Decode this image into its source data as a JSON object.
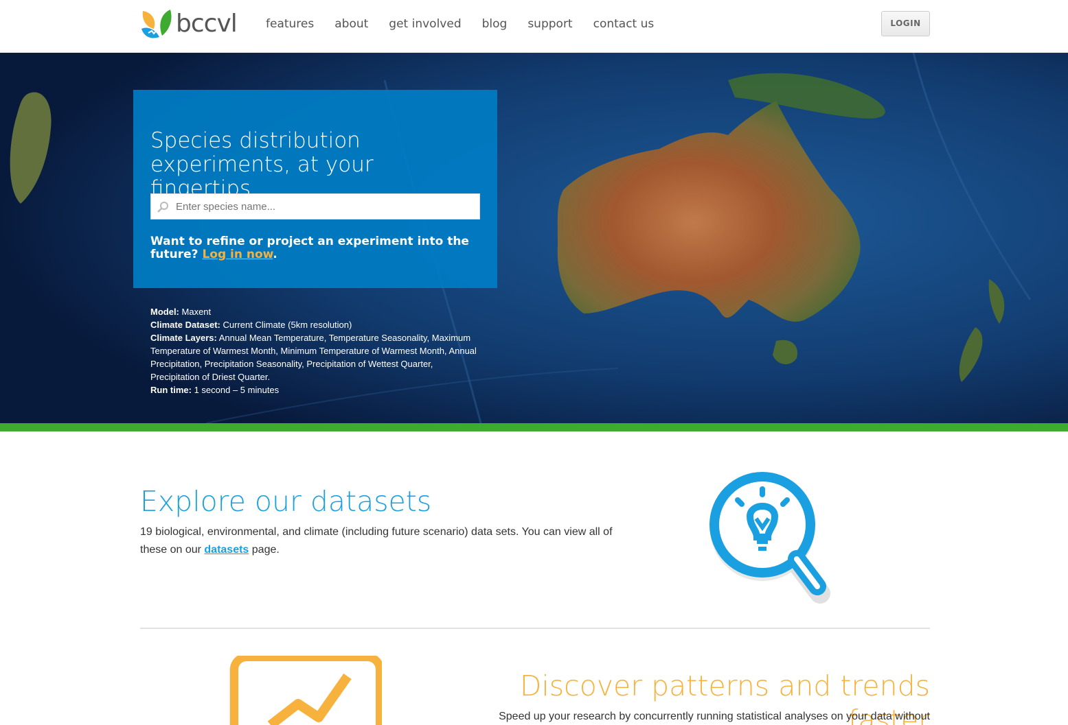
{
  "brand": {
    "name": "bccvl"
  },
  "nav": {
    "items": [
      "features",
      "about",
      "get involved",
      "blog",
      "support",
      "contact us"
    ]
  },
  "header": {
    "login_label": "LOGIN"
  },
  "hero": {
    "title": "Species distribution experiments, at your fingertips.",
    "search_placeholder": "Enter species name...",
    "refine_text": "Want to refine or project an experiment into the future?",
    "login_link": "Log in now",
    "refine_suffix": ".",
    "meta": {
      "model_label": "Model:",
      "model_value": "Maxent",
      "dataset_label": "Climate Dataset:",
      "dataset_value": "Current Climate (5km resolution)",
      "layers_label": "Climate Layers:",
      "layers_value": "Annual Mean Temperature, Temperature Seasonality, Maximum Temperature of Warmest Month, Minimum Temperature of Warmest Month, Annual Precipitation, Precipitation Seasonality, Precipitation of Wettest Quarter, Precipitation of Driest Quarter.",
      "runtime_label": "Run time:",
      "runtime_value": "1 second – 5 minutes"
    }
  },
  "datasets": {
    "title": "Explore our datasets",
    "text_before": "19 biological, environmental, and climate (including future scenario) data sets. You can view all of these on our",
    "link": "datasets",
    "text_after": "page."
  },
  "discover": {
    "title": "Discover patterns and trends faster",
    "text": "Speed up your research by concurrently running statistical analyses on your data without"
  },
  "colors": {
    "accent_blue": "#1a9fe0",
    "accent_orange": "#f6b23d",
    "green_bar": "#3eaa2f",
    "hero_box": "#007dc4"
  },
  "icons": [
    "logo-leaf-icon",
    "search-icon",
    "lightbulb-magnifier-icon",
    "trend-chart-icon"
  ]
}
